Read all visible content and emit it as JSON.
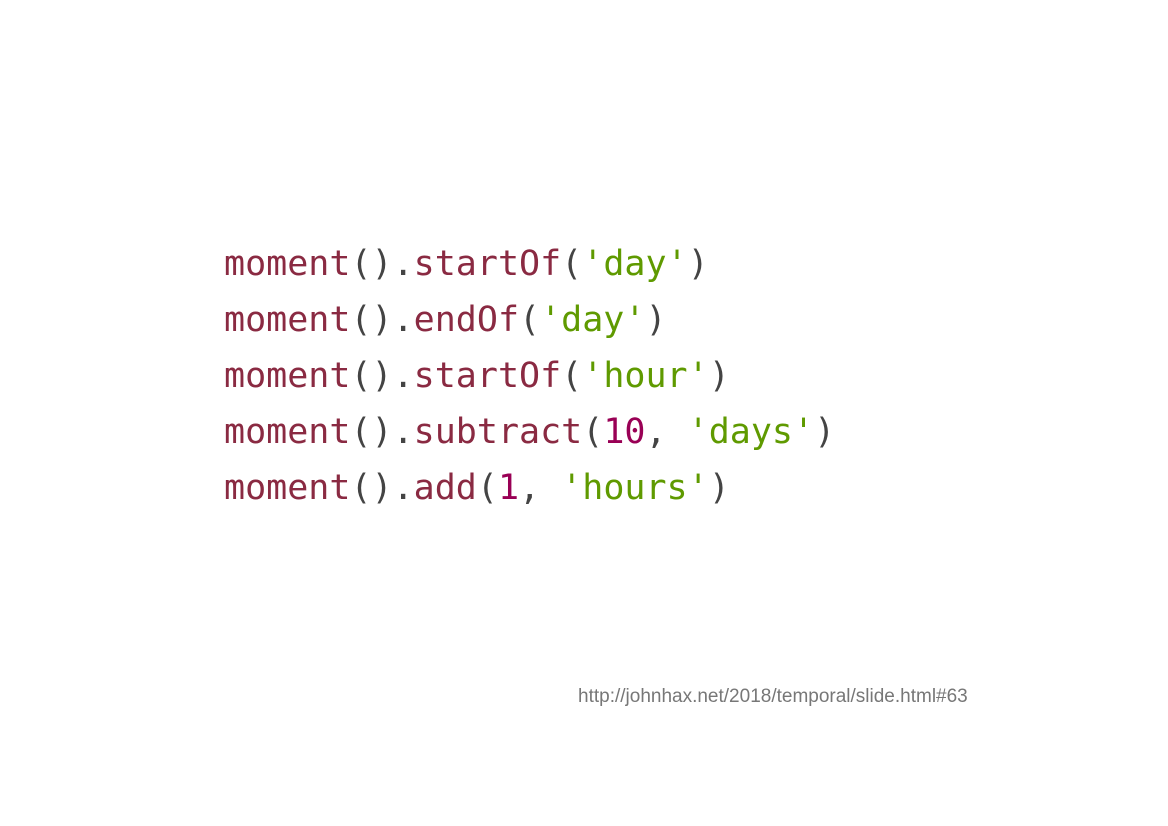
{
  "code_lines": [
    [
      {
        "t": "fn",
        "v": "moment"
      },
      {
        "t": "p",
        "v": "()."
      },
      {
        "t": "fn",
        "v": "startOf"
      },
      {
        "t": "p",
        "v": "("
      },
      {
        "t": "s",
        "v": "'day'"
      },
      {
        "t": "p",
        "v": ")"
      }
    ],
    [
      {
        "t": "fn",
        "v": "moment"
      },
      {
        "t": "p",
        "v": "()."
      },
      {
        "t": "fn",
        "v": "endOf"
      },
      {
        "t": "p",
        "v": "("
      },
      {
        "t": "s",
        "v": "'day'"
      },
      {
        "t": "p",
        "v": ")"
      }
    ],
    [
      {
        "t": "fn",
        "v": "moment"
      },
      {
        "t": "p",
        "v": "()."
      },
      {
        "t": "fn",
        "v": "startOf"
      },
      {
        "t": "p",
        "v": "("
      },
      {
        "t": "s",
        "v": "'hour'"
      },
      {
        "t": "p",
        "v": ")"
      }
    ],
    [
      {
        "t": "fn",
        "v": "moment"
      },
      {
        "t": "p",
        "v": "()."
      },
      {
        "t": "fn",
        "v": "subtract"
      },
      {
        "t": "p",
        "v": "("
      },
      {
        "t": "n",
        "v": "10"
      },
      {
        "t": "p",
        "v": ", "
      },
      {
        "t": "s",
        "v": "'days'"
      },
      {
        "t": "p",
        "v": ")"
      }
    ],
    [
      {
        "t": "fn",
        "v": "moment"
      },
      {
        "t": "p",
        "v": "()."
      },
      {
        "t": "fn",
        "v": "add"
      },
      {
        "t": "p",
        "v": "("
      },
      {
        "t": "n",
        "v": "1"
      },
      {
        "t": "p",
        "v": ", "
      },
      {
        "t": "s",
        "v": "'hours'"
      },
      {
        "t": "p",
        "v": ")"
      }
    ]
  ],
  "footer": {
    "url": "http://johnhax.net/2018/temporal/slide.html#63"
  },
  "colors": {
    "function": "#8a2a42",
    "punctuation": "#444444",
    "string": "#5f9a00",
    "number": "#990055"
  }
}
